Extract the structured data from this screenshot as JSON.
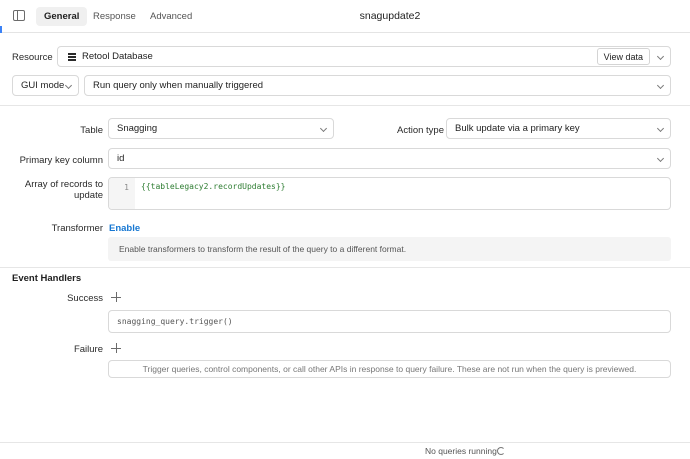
{
  "tabs": [
    {
      "label": "General",
      "active": true
    },
    {
      "label": "Response",
      "active": false
    },
    {
      "label": "Advanced",
      "active": false
    }
  ],
  "query_name": "snagupdate2",
  "resource": {
    "label": "Resource",
    "value": "Retool Database",
    "view_button": "View data"
  },
  "mode": {
    "value": "GUI mode",
    "trigger": "Run query only when manually triggered"
  },
  "table": {
    "label": "Table",
    "value": "Snagging"
  },
  "action": {
    "label": "Action type",
    "value": "Bulk update via a primary key"
  },
  "primary_key": {
    "label": "Primary key column",
    "value": "id"
  },
  "records": {
    "label_line1": "Array of records to",
    "label_line2": "update",
    "line_number": "1",
    "code": "{{tableLegacy2.recordUpdates}}"
  },
  "transformer": {
    "label": "Transformer",
    "enable": "Enable",
    "hint": "Enable transformers to transform the result of the query to a different format."
  },
  "event_handlers": {
    "heading": "Event Handlers",
    "success_label": "Success",
    "success_handler": "snagging_query.trigger()",
    "failure_label": "Failure",
    "failure_hint": "Trigger queries, control components, or call other APIs in response to query failure. These are not run when the query is previewed."
  },
  "footer": {
    "status": "No queries running"
  }
}
